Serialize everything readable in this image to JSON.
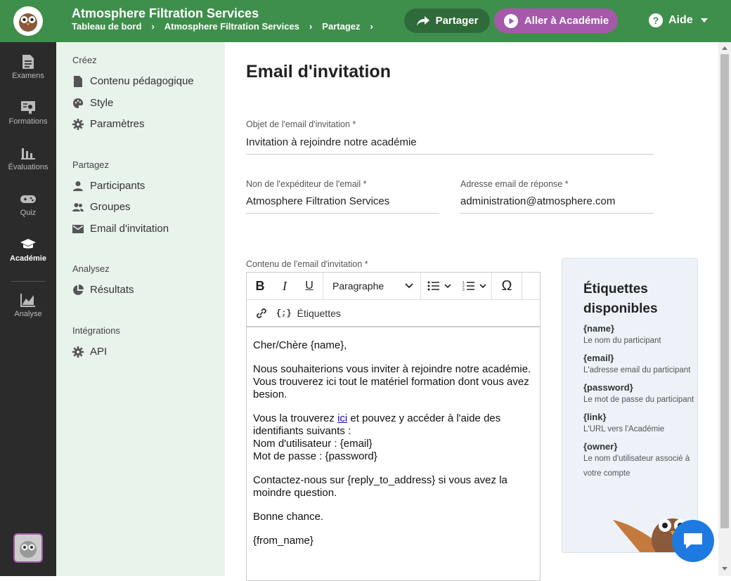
{
  "header": {
    "title": "Atmosphere Filtration Services",
    "breadcrumbs": [
      "Tableau de bord",
      "Atmosphere Filtration Services",
      "Partagez"
    ],
    "share_label": "Partager",
    "academy_label": "Aller à Académie",
    "help_label": "Aide"
  },
  "rail": {
    "items": [
      {
        "label": "Examens"
      },
      {
        "label": "Formations"
      },
      {
        "label": "Évaluations"
      },
      {
        "label": "Quiz"
      },
      {
        "label": "Académie"
      },
      {
        "label": "Analyse"
      }
    ]
  },
  "subnav": {
    "sections": [
      {
        "title": "Créez",
        "items": [
          "Contenu pédagogique",
          "Style",
          "Paramètres"
        ]
      },
      {
        "title": "Partagez",
        "items": [
          "Participants",
          "Groupes",
          "Email d'invitation"
        ]
      },
      {
        "title": "Analysez",
        "items": [
          "Résultats"
        ]
      },
      {
        "title": "Intégrations",
        "items": [
          "API"
        ]
      }
    ]
  },
  "page": {
    "title": "Email d'invitation",
    "subject_label": "Objet de l'email d'invitation *",
    "subject_value": "Invitation à rejoindre notre académie",
    "sender_label": "Non de l'expéditeur de l'email *",
    "sender_value": "Atmosphere Filtration Services",
    "reply_label": "Adresse email de réponse *",
    "reply_value": "administration@atmosphere.com",
    "content_label": "Contenu de l'email d'invitation *"
  },
  "editor": {
    "paragraph_select": "Paragraphe",
    "tags_button": "Étiquettes",
    "content": {
      "greeting": "Cher/Chère {name},",
      "p1": "Nous souhaiterions vous inviter à rejoindre notre académie. Vous trouverez ici tout le matériel formation dont vous avez besion.",
      "p2_before": "Vous la trouverez ",
      "p2_link": "ici",
      "p2_after": " et pouvez y accéder à l'aide des identifiants suivants :",
      "p2_user": "Nom d'utilisateur : {email}",
      "p2_pass": "Mot de passe : {password}",
      "p3": "Contactez-nous sur {reply_to_address} si vous avez la moindre question.",
      "p4": "Bonne chance.",
      "p5": "{from_name}"
    }
  },
  "tags_panel": {
    "title": "Étiquettes disponibles",
    "tags": [
      {
        "name": "{name}",
        "desc": "Le nom du participant"
      },
      {
        "name": "{email}",
        "desc": "L'adresse email du participant"
      },
      {
        "name": "{password}",
        "desc": "Le mot de passe du participant"
      },
      {
        "name": "{link}",
        "desc": "L'URL vers l'Académie"
      },
      {
        "name": "{owner}",
        "desc": "Le nom d'utilisateur associé à votre compte"
      }
    ]
  },
  "colors": {
    "header_green": "#3f8f4c",
    "share_green": "#2f6b3a",
    "academy_purple": "#a45aa8",
    "rail_dark": "#2b2b2b",
    "subnav_bg": "#e8f3ec",
    "chat_blue": "#1e7ae0"
  }
}
